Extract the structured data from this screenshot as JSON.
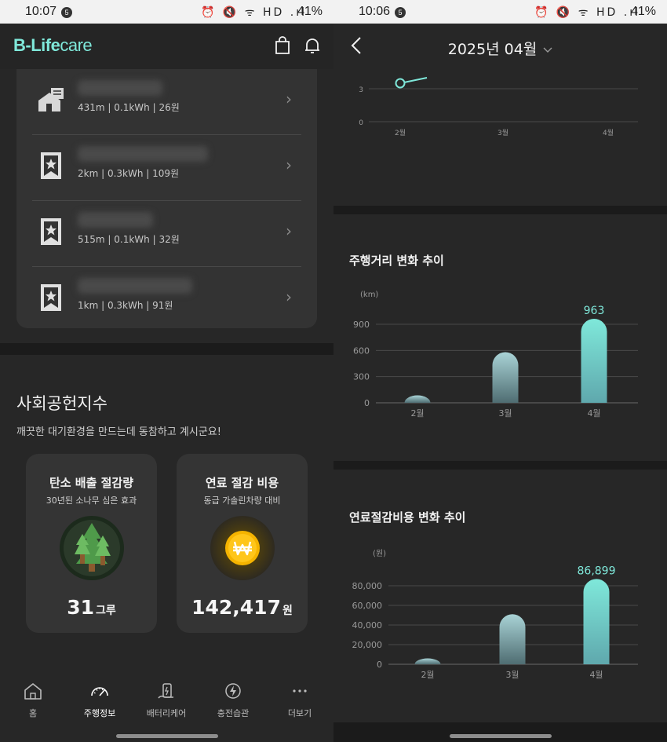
{
  "left": {
    "status": {
      "time": "10:07",
      "badge": "5",
      "battery": "41%",
      "icons": "⏰ 🔇 ᯤ HD .ıl"
    },
    "logo": {
      "b": "B-Life",
      "care": "care"
    },
    "stations": [
      {
        "info": "431m | 0.1kWh | 26원",
        "icon": "home-icon",
        "blur_w": 108
      },
      {
        "info": "2km | 0.3kWh | 109원",
        "icon": "bookmark-star-icon",
        "blur_w": 166
      },
      {
        "info": "515m | 0.1kWh | 32원",
        "icon": "bookmark-star-icon",
        "blur_w": 96
      },
      {
        "info": "1km | 0.3kWh | 91원",
        "icon": "bookmark-star-icon",
        "blur_w": 146
      }
    ],
    "social": {
      "title": "사회공헌지수",
      "subtitle": "깨끗한 대기환경을 만드는데 동참하고 계시군요!",
      "carbon": {
        "title": "탄소 배출 절감량",
        "sub": "30년된 소나무 심은 효과",
        "value": "31",
        "unit": "그루"
      },
      "fuel": {
        "title": "연료 절감 비용",
        "sub": "동급 가솔린차량 대비",
        "value": "142,417",
        "unit": "원"
      }
    },
    "nav": [
      {
        "label": "홈",
        "icon": "home-icon"
      },
      {
        "label": "주행정보",
        "icon": "speedometer-icon"
      },
      {
        "label": "배터리케어",
        "icon": "battery-care-icon"
      },
      {
        "label": "충전습관",
        "icon": "charge-icon"
      },
      {
        "label": "더보기",
        "icon": "more-icon"
      }
    ]
  },
  "right": {
    "status": {
      "time": "10:06",
      "badge": "5",
      "battery": "41%",
      "icons": "⏰ 🔇 ᯤ HD .ıl"
    },
    "period": "2025년 04월",
    "charts": {
      "top": {
        "categories": [
          "2월",
          "3월",
          "4월"
        ],
        "y_ticks": [
          "3",
          "0"
        ]
      },
      "distance": {
        "title": "주행거리 변화 추이",
        "unit": "(km)",
        "highlight": "963"
      },
      "fuel": {
        "title": "연료절감비용 변화 추이",
        "unit": "(원)",
        "highlight": "86,899"
      }
    }
  },
  "chart_data": [
    {
      "type": "line",
      "categories": [
        "2월",
        "3월",
        "4월"
      ],
      "ylim": [
        0,
        3
      ],
      "y_ticks": [
        0,
        3
      ],
      "note_values": [
        3.5,
        null,
        null
      ]
    },
    {
      "type": "bar",
      "title": "주행거리 변화 추이",
      "ylabel": "(km)",
      "categories": [
        "2월",
        "3월",
        "4월"
      ],
      "values": [
        85,
        580,
        963
      ],
      "ylim": [
        0,
        900
      ],
      "y_ticks": [
        0,
        300,
        600,
        900
      ],
      "data_labels": [
        "",
        "",
        "963"
      ]
    },
    {
      "type": "bar",
      "title": "연료절감비용 변화 추이",
      "ylabel": "(원)",
      "categories": [
        "2월",
        "3월",
        "4월"
      ],
      "values": [
        6000,
        51000,
        86899
      ],
      "ylim": [
        0,
        80000
      ],
      "y_ticks": [
        0,
        20000,
        40000,
        60000,
        80000
      ],
      "y_tick_labels": [
        "0",
        "20,000",
        "40,000",
        "60,000",
        "80,000"
      ],
      "data_labels": [
        "",
        "",
        "86,899"
      ]
    }
  ],
  "colors": {
    "accent": "#7fe8da",
    "bar_top": "#7fe8da",
    "bar_mid": "#9ccad0",
    "bar_dim": "#4f6d72",
    "grid": "#4a4a4a",
    "tree": "#3f7a3c",
    "coin": "#f5b400"
  }
}
